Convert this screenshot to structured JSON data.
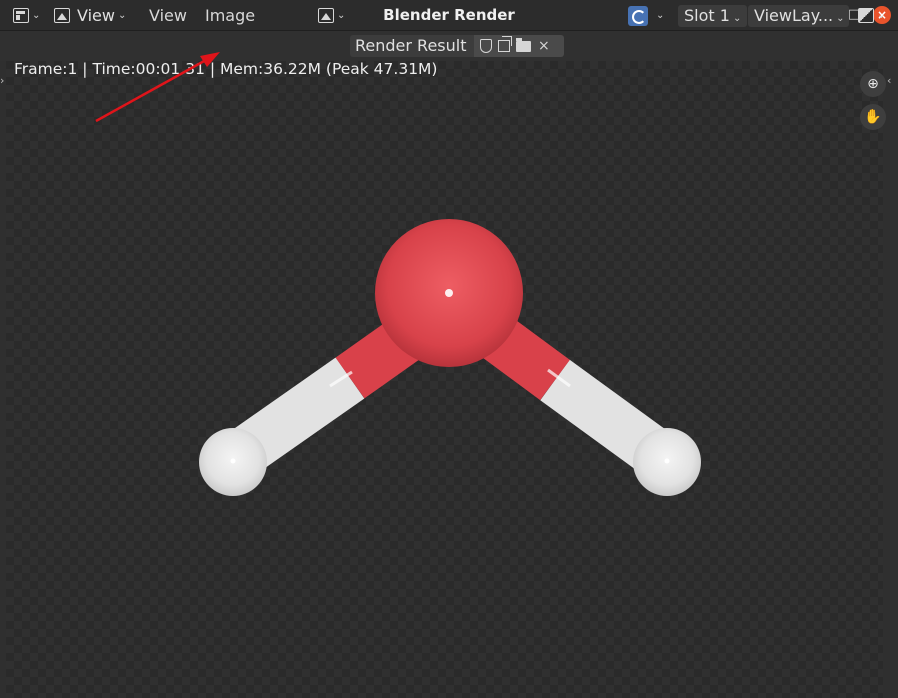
{
  "window": {
    "title": "Blender Render",
    "minimize": "–",
    "maximize": "□",
    "close": "×"
  },
  "header": {
    "view_mode_label": "View",
    "menus": [
      "View",
      "Image"
    ],
    "image_name": "Render Result",
    "slot_label": "Slot 1",
    "view_layer_label": "ViewLay...",
    "close_glyph": "×",
    "chevron": "⌄"
  },
  "stats_text": "Frame:1 | Time:00:01.31 | Mem:36.22M (Peak 47.31M)",
  "icons": {
    "editor_type": "image-editor-icon",
    "view_mode": "image-view-icon",
    "browse_image": "browse-image-icon",
    "fake_user": "shield-icon",
    "new_image": "duplicate-icon",
    "open_image": "folder-icon",
    "unlink": "close-icon",
    "display_channels": "display-channels-icon",
    "zoom": "zoom-icon",
    "pan": "hand-icon"
  },
  "render_scene": {
    "subject": "water-molecule",
    "colors": {
      "oxygen": "#d9414a",
      "hydrogen": "#e4e4e4",
      "background_dark": "#2a2a2a",
      "background_light": "#303030"
    }
  },
  "annotation": {
    "arrow_color": "#e0141a"
  }
}
